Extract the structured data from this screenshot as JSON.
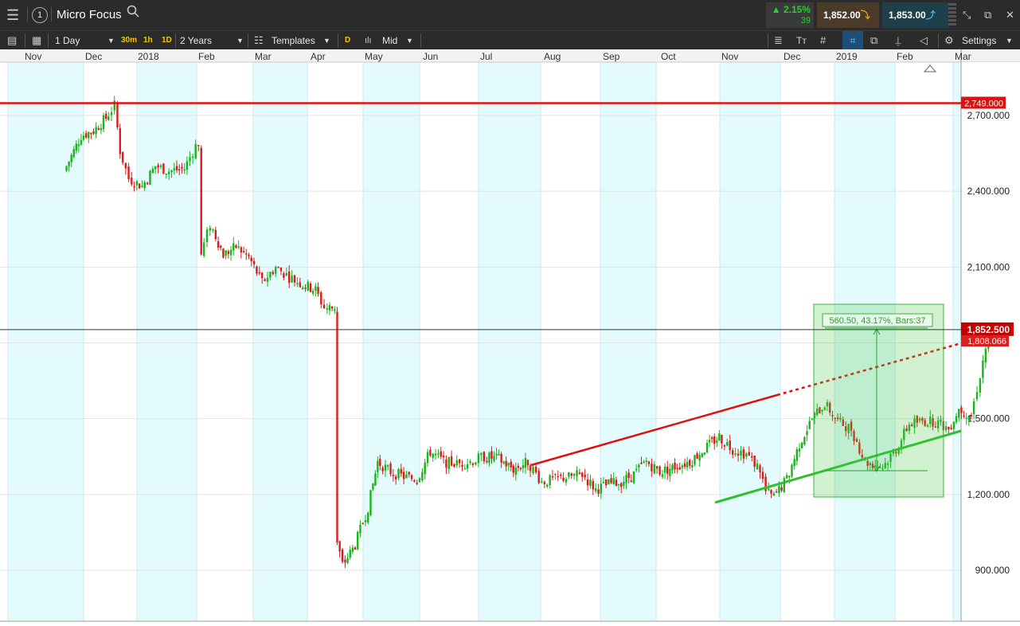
{
  "header": {
    "menu_icon": "hamburger-icon",
    "info_icon": "info-circle-icon",
    "instrument": "Micro Focus",
    "search_icon": "search-icon",
    "change_pct": "▲ 2.15%",
    "change_abs": "39",
    "sell_price": "1,852.00",
    "buy_price": "1,853.00",
    "minimize_icon": "minimize-icon",
    "popout_icon": "popout-icon",
    "close_icon": "close-icon"
  },
  "toolbar": {
    "interval": "1 Day",
    "quick_30m": "30m",
    "quick_1h": "1h",
    "quick_1d": "1D",
    "range": "2 Years",
    "templates": "Templates",
    "d_button": "D",
    "price_type": "Mid",
    "settings": "Settings"
  },
  "chart_data": {
    "type": "candlestick",
    "instrument": "Micro Focus",
    "x_labels": [
      "Nov",
      "Dec",
      "2018",
      "Feb",
      "Mar",
      "Apr",
      "May",
      "Jun",
      "Jul",
      "Aug",
      "Sep",
      "Oct",
      "Nov",
      "Dec",
      "2019",
      "Feb",
      "Mar"
    ],
    "y_ticks": [
      "2,700.000",
      "2,400.000",
      "2,100.000",
      "1,500.000",
      "1,200.000",
      "900.000"
    ],
    "ylim": [
      790,
      2950
    ],
    "grid": true,
    "current_price": {
      "value": 1852.5,
      "label": "1,852.500"
    },
    "horizontal_line": {
      "value": 2749,
      "label": "2,749.000"
    },
    "trend_line_label": "1,808.066",
    "measure_label": "560.50, 43.17%, Bars:37",
    "close_series": [
      {
        "date": "2017-10-25",
        "close": 2480
      },
      {
        "date": "2017-11-01",
        "close": 2620
      },
      {
        "date": "2017-11-08",
        "close": 2640
      },
      {
        "date": "2017-11-15",
        "close": 2690
      },
      {
        "date": "2017-11-20",
        "close": 2740
      },
      {
        "date": "2017-11-23",
        "close": 2560
      },
      {
        "date": "2017-11-28",
        "close": 2450
      },
      {
        "date": "2017-12-05",
        "close": 2420
      },
      {
        "date": "2017-12-12",
        "close": 2500
      },
      {
        "date": "2017-12-19",
        "close": 2480
      },
      {
        "date": "2017-12-27",
        "close": 2490
      },
      {
        "date": "2018-01-02",
        "close": 2580
      },
      {
        "date": "2018-01-05",
        "close": 2150
      },
      {
        "date": "2018-01-10",
        "close": 2270
      },
      {
        "date": "2018-01-17",
        "close": 2150
      },
      {
        "date": "2018-01-24",
        "close": 2180
      },
      {
        "date": "2018-01-31",
        "close": 2140
      },
      {
        "date": "2018-02-07",
        "close": 2040
      },
      {
        "date": "2018-02-14",
        "close": 2100
      },
      {
        "date": "2018-02-21",
        "close": 2060
      },
      {
        "date": "2018-02-28",
        "close": 2030
      },
      {
        "date": "2018-03-07",
        "close": 2010
      },
      {
        "date": "2018-03-12",
        "close": 1940
      },
      {
        "date": "2018-03-19",
        "close": 1010
      },
      {
        "date": "2018-03-22",
        "close": 920
      },
      {
        "date": "2018-03-29",
        "close": 1000
      },
      {
        "date": "2018-04-05",
        "close": 1150
      },
      {
        "date": "2018-04-10",
        "close": 1330
      },
      {
        "date": "2018-04-17",
        "close": 1290
      },
      {
        "date": "2018-04-24",
        "close": 1270
      },
      {
        "date": "2018-05-01",
        "close": 1260
      },
      {
        "date": "2018-05-08",
        "close": 1370
      },
      {
        "date": "2018-05-15",
        "close": 1330
      },
      {
        "date": "2018-05-22",
        "close": 1320
      },
      {
        "date": "2018-05-29",
        "close": 1330
      },
      {
        "date": "2018-06-05",
        "close": 1350
      },
      {
        "date": "2018-06-12",
        "close": 1340
      },
      {
        "date": "2018-06-19",
        "close": 1300
      },
      {
        "date": "2018-06-26",
        "close": 1330
      },
      {
        "date": "2018-07-03",
        "close": 1250
      },
      {
        "date": "2018-07-10",
        "close": 1260
      },
      {
        "date": "2018-07-17",
        "close": 1270
      },
      {
        "date": "2018-07-24",
        "close": 1280
      },
      {
        "date": "2018-07-31",
        "close": 1220
      },
      {
        "date": "2018-08-07",
        "close": 1240
      },
      {
        "date": "2018-08-14",
        "close": 1250
      },
      {
        "date": "2018-08-21",
        "close": 1280
      },
      {
        "date": "2018-08-28",
        "close": 1330
      },
      {
        "date": "2018-09-04",
        "close": 1290
      },
      {
        "date": "2018-09-11",
        "close": 1310
      },
      {
        "date": "2018-09-18",
        "close": 1330
      },
      {
        "date": "2018-09-25",
        "close": 1380
      },
      {
        "date": "2018-10-02",
        "close": 1430
      },
      {
        "date": "2018-10-09",
        "close": 1380
      },
      {
        "date": "2018-10-16",
        "close": 1360
      },
      {
        "date": "2018-10-23",
        "close": 1300
      },
      {
        "date": "2018-10-26",
        "close": 1210
      },
      {
        "date": "2018-10-30",
        "close": 1190
      },
      {
        "date": "2018-11-06",
        "close": 1260
      },
      {
        "date": "2018-11-13",
        "close": 1400
      },
      {
        "date": "2018-11-20",
        "close": 1500
      },
      {
        "date": "2018-11-27",
        "close": 1560
      },
      {
        "date": "2018-12-04",
        "close": 1490
      },
      {
        "date": "2018-12-11",
        "close": 1460
      },
      {
        "date": "2018-12-18",
        "close": 1330
      },
      {
        "date": "2018-12-27",
        "close": 1310
      },
      {
        "date": "2019-01-03",
        "close": 1380
      },
      {
        "date": "2019-01-10",
        "close": 1480
      },
      {
        "date": "2019-01-17",
        "close": 1490
      },
      {
        "date": "2019-01-24",
        "close": 1490
      },
      {
        "date": "2019-01-31",
        "close": 1460
      },
      {
        "date": "2019-02-05",
        "close": 1540
      },
      {
        "date": "2019-02-11",
        "close": 1510
      },
      {
        "date": "2019-02-14",
        "close": 1620
      },
      {
        "date": "2019-02-18",
        "close": 1780
      },
      {
        "date": "2019-02-20",
        "close": 1852
      }
    ]
  }
}
